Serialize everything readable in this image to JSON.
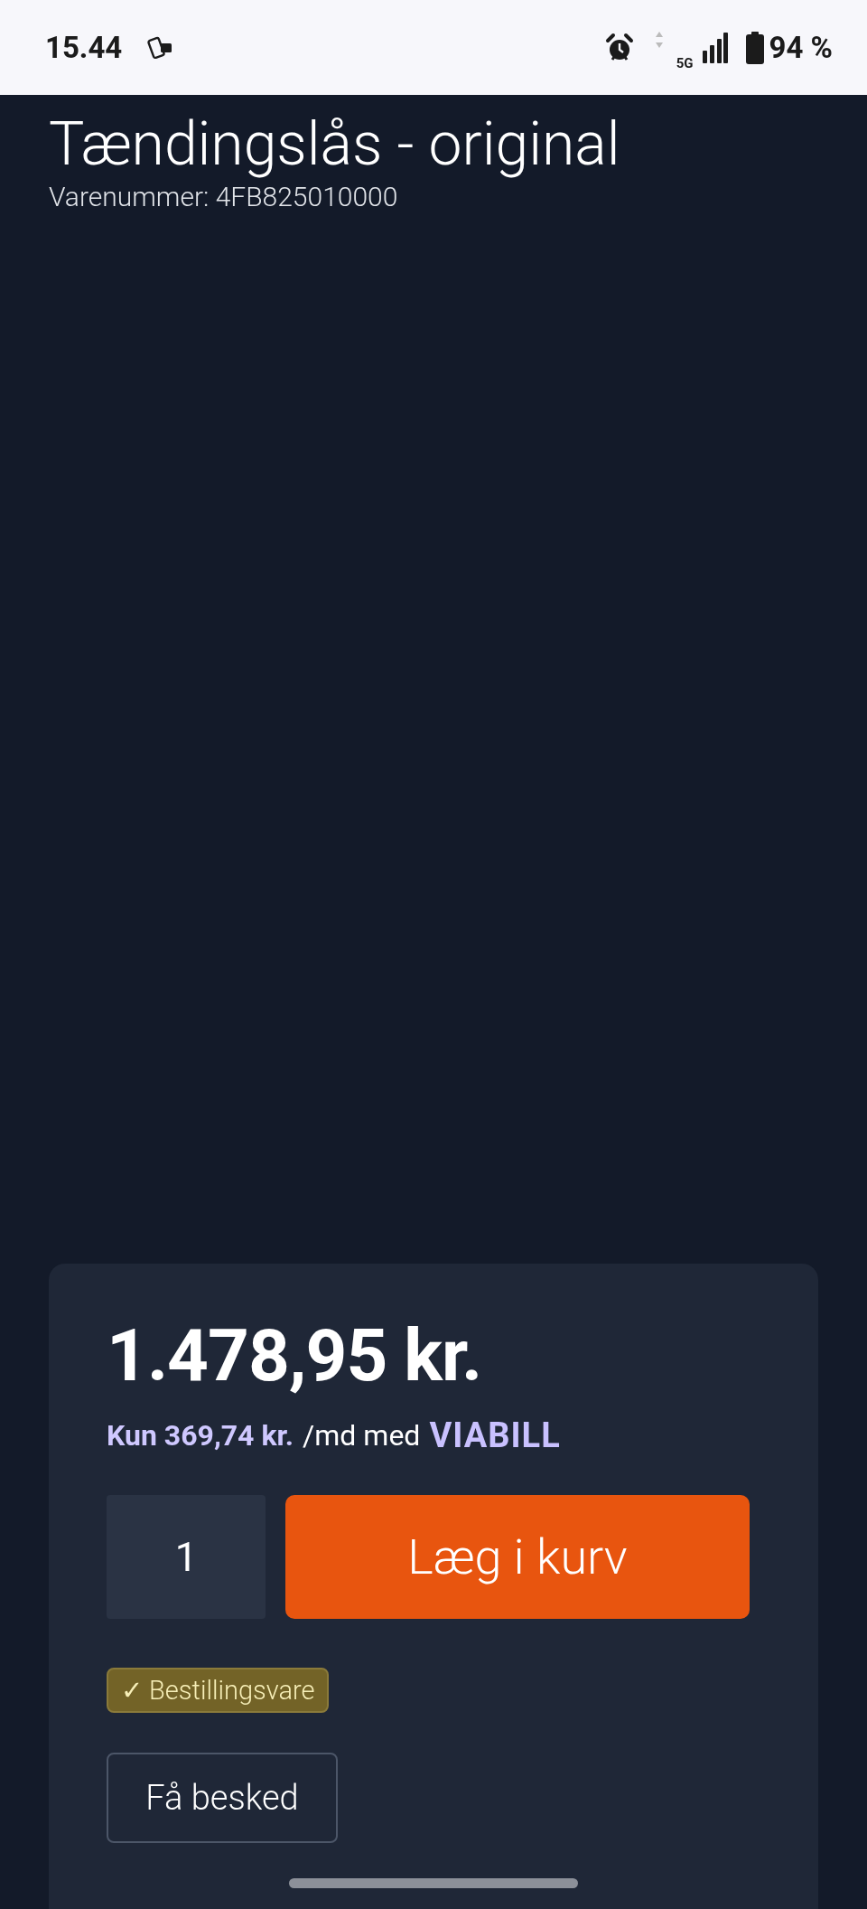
{
  "status_bar": {
    "time": "15.44",
    "network": "5G",
    "battery": "94 %"
  },
  "product": {
    "title": "Tændingslås - original",
    "sku": "Varenummer: 4FB825010000"
  },
  "price_card": {
    "price": "1.478,95 kr.",
    "financing": {
      "amount": "Kun 369,74 kr.",
      "text": "/md med",
      "provider": "VIABILL"
    },
    "quantity": "1",
    "add_button": "Læg i kurv",
    "badge": "✓ Bestillingsvare",
    "notify_button": "Få besked"
  }
}
